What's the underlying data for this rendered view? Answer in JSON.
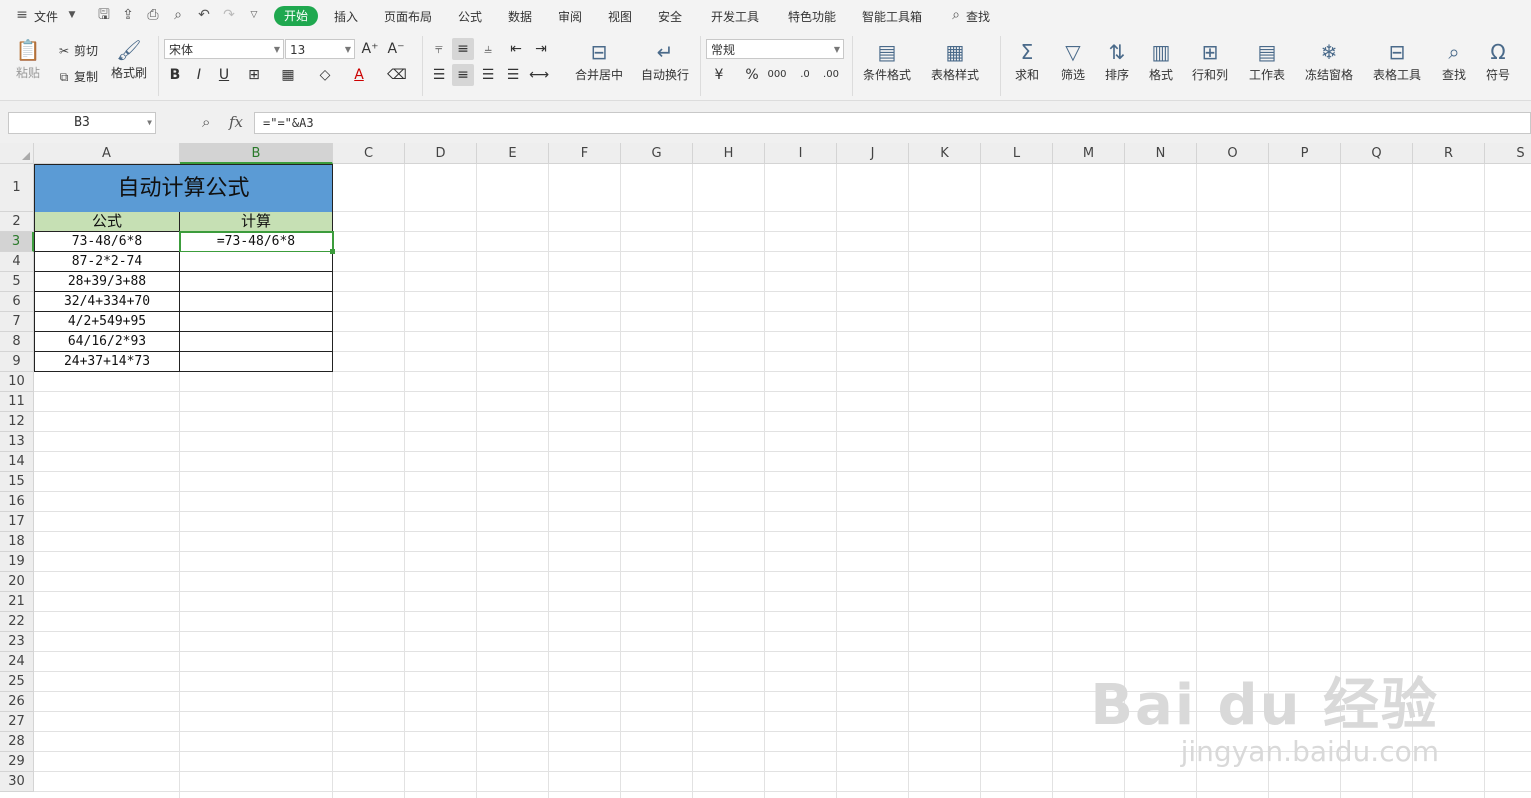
{
  "menubar": {
    "file_label": "文件",
    "tabs": [
      "开始",
      "插入",
      "页面布局",
      "公式",
      "数据",
      "审阅",
      "视图",
      "安全",
      "开发工具",
      "特色功能",
      "智能工具箱"
    ],
    "active_tab": "开始",
    "search_label": "查找"
  },
  "ribbon": {
    "paste": "粘贴",
    "cut": "剪切",
    "copy": "复制",
    "format_painter": "格式刷",
    "font_name": "宋体",
    "font_size": "13",
    "merge_center": "合并居中",
    "wrap_text": "自动换行",
    "number_format": "常规",
    "conditional_format": "条件格式",
    "table_style": "表格样式",
    "sum": "求和",
    "filter": "筛选",
    "sort": "排序",
    "format": "格式",
    "row_col": "行和列",
    "worksheet": "工作表",
    "freeze": "冻结窗格",
    "table_tools": "表格工具",
    "find": "查找",
    "symbol": "符号"
  },
  "formula_bar": {
    "name_box": "B3",
    "fx": "fx",
    "formula": "=\"=\"&A3"
  },
  "sheet": {
    "columns": [
      "A",
      "B",
      "C",
      "D",
      "E",
      "F",
      "G",
      "H",
      "I",
      "J",
      "K",
      "L",
      "M",
      "N",
      "O",
      "P",
      "Q",
      "R",
      "S"
    ],
    "rows": [
      "1",
      "2",
      "3",
      "4",
      "5",
      "6",
      "7",
      "8",
      "9",
      "10",
      "11",
      "12",
      "13",
      "14",
      "15",
      "16",
      "17",
      "18",
      "19",
      "20",
      "21",
      "22",
      "23",
      "24",
      "25",
      "26",
      "27",
      "28",
      "29",
      "30"
    ],
    "title": "自动计算公式",
    "header_a": "公式",
    "header_b": "计算",
    "formulas": [
      "73-48/6*8",
      "87-2*2-74",
      "28+39/3+88",
      "32/4+334+70",
      "4/2+549+95",
      "64/16/2*93",
      "24+37+14*73"
    ],
    "results": [
      "=73-48/6*8",
      "",
      "",
      "",
      "",
      "",
      ""
    ]
  },
  "watermark": {
    "brand": "Bai du 经验",
    "url": "jingyan.baidu.com"
  }
}
